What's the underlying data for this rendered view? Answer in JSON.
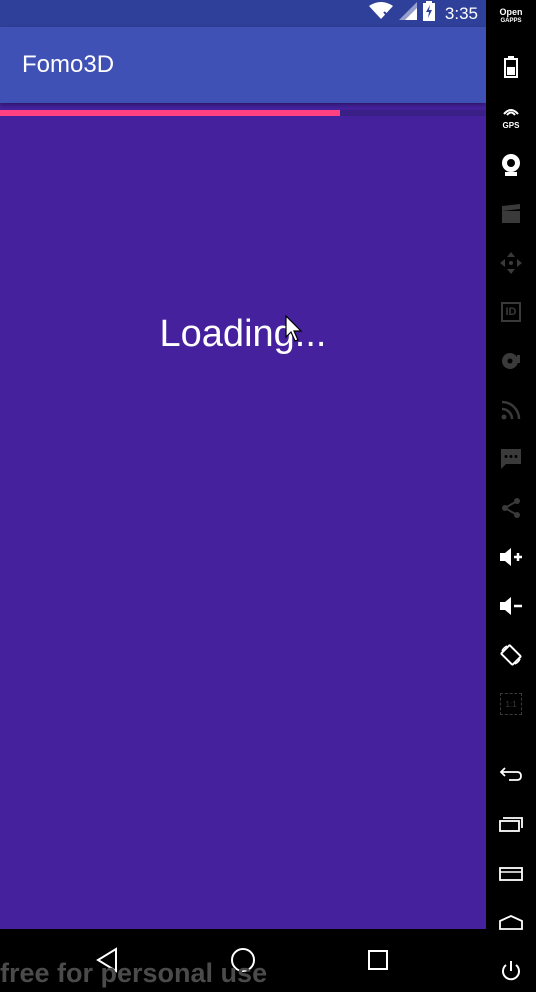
{
  "status_bar": {
    "time": "3:35"
  },
  "app_bar": {
    "title": "Fomo3D"
  },
  "progress": {
    "value_percent": 70,
    "color": "#ff4081"
  },
  "main": {
    "loading_text": "Loading..."
  },
  "watermark": {
    "text": "free for personal use"
  },
  "side_toolbar": {
    "brand_line1": "Open",
    "brand_line2": "GAPPS",
    "gps_label": "GPS",
    "id_label": "ID",
    "ratio_label": "1:1"
  },
  "colors": {
    "background": "#45219d",
    "status_bar": "#2f409a",
    "app_bar": "#3f51b5",
    "accent": "#ff4081"
  }
}
